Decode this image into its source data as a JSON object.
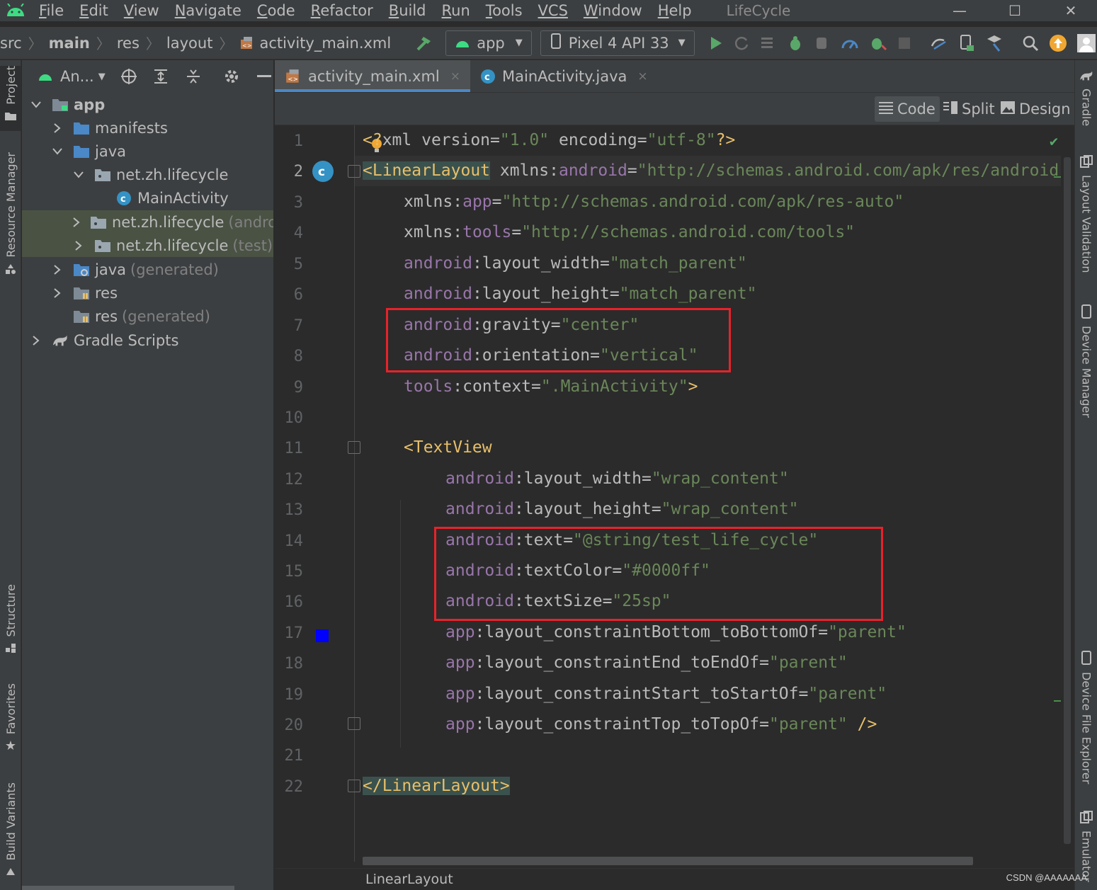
{
  "menubar": {
    "items": [
      {
        "mnemonic": "F",
        "rest": "ile"
      },
      {
        "mnemonic": "E",
        "rest": "dit"
      },
      {
        "mnemonic": "V",
        "rest": "iew"
      },
      {
        "mnemonic": "N",
        "rest": "avigate"
      },
      {
        "mnemonic": "C",
        "rest": "ode"
      },
      {
        "mnemonic": "R",
        "rest": "efactor"
      },
      {
        "mnemonic": "B",
        "rest": "uild"
      },
      {
        "mnemonic": "R",
        "rest": "un"
      },
      {
        "mnemonic": "T",
        "rest": "ools"
      },
      {
        "mnemonic": "",
        "rest": "VCS"
      },
      {
        "mnemonic": "W",
        "rest": "indow"
      },
      {
        "mnemonic": "H",
        "rest": "elp"
      }
    ],
    "project_title": "LifeCycle",
    "window_controls": {
      "minimize": "—",
      "maximize": "☐",
      "close": "✕"
    }
  },
  "breadcrumb": [
    "src",
    "main",
    "res",
    "layout",
    "activity_main.xml"
  ],
  "toolbar": {
    "run_config": "app",
    "device": "Pixel 4 API 33"
  },
  "left_strip": {
    "project": "Project",
    "resource_manager": "Resource Manager",
    "structure": "Structure",
    "favorites": "Favorites",
    "build_variants": "Build Variants"
  },
  "right_strip": {
    "gradle": "Gradle",
    "layout_validation": "Layout Validation",
    "device_manager": "Device Manager",
    "device_file_explorer": "Device File Explorer",
    "emulator": "Emulator"
  },
  "project_panel": {
    "view_mode": "An...",
    "tree": [
      {
        "label": "app",
        "suffix": ""
      },
      {
        "label": "manifests",
        "suffix": ""
      },
      {
        "label": "java",
        "suffix": ""
      },
      {
        "label": "net.zh.lifecycle",
        "suffix": ""
      },
      {
        "label": "MainActivity",
        "suffix": ""
      },
      {
        "label": "net.zh.lifecycle",
        "suffix": "(androidTest)"
      },
      {
        "label": "net.zh.lifecycle",
        "suffix": "(test)"
      },
      {
        "label": "java",
        "suffix": "(generated)"
      },
      {
        "label": "res",
        "suffix": ""
      },
      {
        "label": "res",
        "suffix": "(generated)"
      },
      {
        "label": "Gradle Scripts",
        "suffix": ""
      }
    ]
  },
  "tabs": [
    {
      "label": "activity_main.xml",
      "close": "×"
    },
    {
      "label": "MainActivity.java",
      "close": "×"
    }
  ],
  "view_modes": {
    "code": "Code",
    "split": "Split",
    "design": "Design"
  },
  "code": {
    "line_numbers": [
      "1",
      "2",
      "3",
      "4",
      "5",
      "6",
      "7",
      "8",
      "9",
      "10",
      "11",
      "12",
      "13",
      "14",
      "15",
      "16",
      "17",
      "18",
      "19",
      "20",
      "21",
      "22"
    ],
    "l1": {
      "a": "<?",
      "b": "xml ",
      "c": "version",
      "d": "=",
      "e": "\"1.0\"",
      "f": " encoding",
      "g": "=",
      "h": "\"utf-8\"",
      "i": "?>"
    },
    "l2": {
      "open": "<",
      "tag": "LinearLayout",
      "attr": " xmlns:",
      "ns": "android",
      "eq": "=",
      "val": "\"http://schemas.android.com/apk/res/android\""
    },
    "l3": {
      "attr": "xmlns:",
      "ns": "app",
      "eq": "=",
      "val": "\"http://schemas.android.com/apk/res-auto\""
    },
    "l4": {
      "attr": "xmlns:",
      "ns": "tools",
      "eq": "=",
      "val": "\"http://schemas.android.com/tools\""
    },
    "l5": {
      "ns": "android",
      "attr": ":layout_width",
      "eq": "=",
      "val": "\"match_parent\""
    },
    "l6": {
      "ns": "android",
      "attr": ":layout_height",
      "eq": "=",
      "val": "\"match_parent\""
    },
    "l7": {
      "ns": "android",
      "attr": ":gravity",
      "eq": "=",
      "val": "\"center\""
    },
    "l8": {
      "ns": "android",
      "attr": ":orientation",
      "eq": "=",
      "val": "\"vertical\""
    },
    "l9": {
      "ns": "tools",
      "attr": ":context",
      "eq": "=",
      "val": "\".MainActivity\"",
      "close": ">"
    },
    "l11": {
      "tag": "<TextView"
    },
    "l12": {
      "ns": "android",
      "attr": ":layout_width",
      "eq": "=",
      "val": "\"wrap_content\""
    },
    "l13": {
      "ns": "android",
      "attr": ":layout_height",
      "eq": "=",
      "val": "\"wrap_content\""
    },
    "l14": {
      "ns": "android",
      "attr": ":text",
      "eq": "=",
      "val": "\"@string/test_life_cycle\""
    },
    "l15": {
      "ns": "android",
      "attr": ":textColor",
      "eq": "=",
      "val": "\"#0000ff\""
    },
    "l16": {
      "ns": "android",
      "attr": ":textSize",
      "eq": "=",
      "val": "\"25sp\""
    },
    "l17": {
      "ns": "app",
      "attr": ":layout_constraintBottom_toBottomOf",
      "eq": "=",
      "val": "\"parent\""
    },
    "l18": {
      "ns": "app",
      "attr": ":layout_constraintEnd_toEndOf",
      "eq": "=",
      "val": "\"parent\""
    },
    "l19": {
      "ns": "app",
      "attr": ":layout_constraintStart_toStartOf",
      "eq": "=",
      "val": "\"parent\""
    },
    "l20": {
      "ns": "app",
      "attr": ":layout_constraintTop_toTopOf",
      "eq": "=",
      "val": "\"parent\"",
      "close": " />"
    },
    "l22": {
      "tag": "</LinearLayout>"
    }
  },
  "colors": {
    "color_swatch": "#0000ff",
    "highlight_box": "#e8222a",
    "accent_tab": "#4a88c7"
  },
  "status": {
    "breadcrumb": "LinearLayout"
  },
  "watermark": "CSDN @AAAAAAA"
}
